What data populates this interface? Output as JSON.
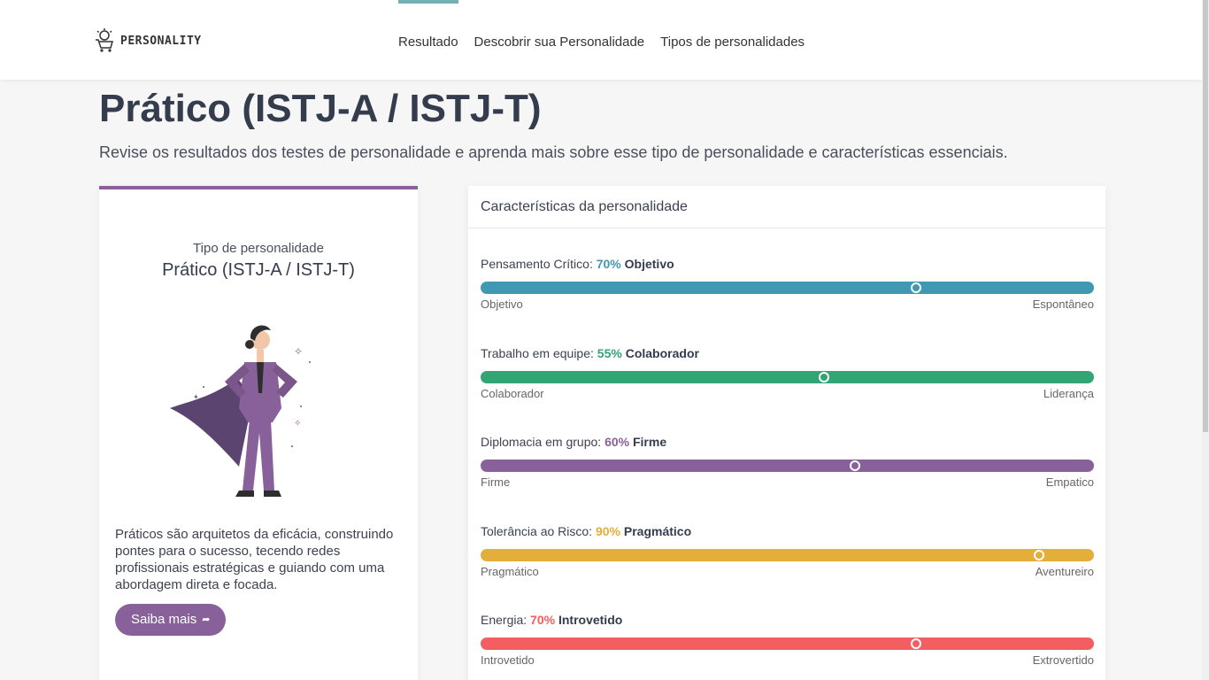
{
  "header": {
    "logo_text": "PERSONALITY",
    "nav": [
      {
        "label": "Resultado",
        "active": true
      },
      {
        "label": "Descobrir sua Personalidade",
        "active": false
      },
      {
        "label": "Tipos de personalidades",
        "active": false
      }
    ]
  },
  "page": {
    "title": "Prático (ISTJ-A / ISTJ-T)",
    "subtitle": "Revise os resultados dos testes de personalidade e aprenda mais sobre esse tipo de personalidade e características essenciais."
  },
  "type_card": {
    "label": "Tipo de personalidade",
    "name": "Prático (ISTJ-A / ISTJ-T)",
    "description": "Práticos são arquitetos da eficácia, construindo pontes para o sucesso, tecendo redes profissionais estratégicas e guiando com uma abordagem direta e focada.",
    "button_label": "Saiba mais",
    "accent_color": "#88619a"
  },
  "traits_card": {
    "title": "Características da personalidade",
    "traits": [
      {
        "name": "Pensamento Crítico:",
        "percent": "70%",
        "result": "Objetivo",
        "left": "Objetivo",
        "right": "Espontâneo",
        "value": 0.71,
        "color": "#4198b3"
      },
      {
        "name": "Trabalho em equipe:",
        "percent": "55%",
        "result": "Colaborador",
        "left": "Colaborador",
        "right": "Liderança",
        "value": 0.56,
        "color": "#33a474"
      },
      {
        "name": "Diplomacia em grupo:",
        "percent": "60%",
        "result": "Firme",
        "left": "Firme",
        "right": "Empatico",
        "value": 0.61,
        "color": "#88619a"
      },
      {
        "name": "Tolerância ao Risco:",
        "percent": "90%",
        "result": "Pragmático",
        "left": "Pragmático",
        "right": "Aventureiro",
        "value": 0.91,
        "color": "#e4ae3a"
      },
      {
        "name": "Energia:",
        "percent": "70%",
        "result": "Introvetido",
        "left": "Introvetido",
        "right": "Extrovertido",
        "value": 0.71,
        "color": "#f25e62"
      }
    ]
  }
}
